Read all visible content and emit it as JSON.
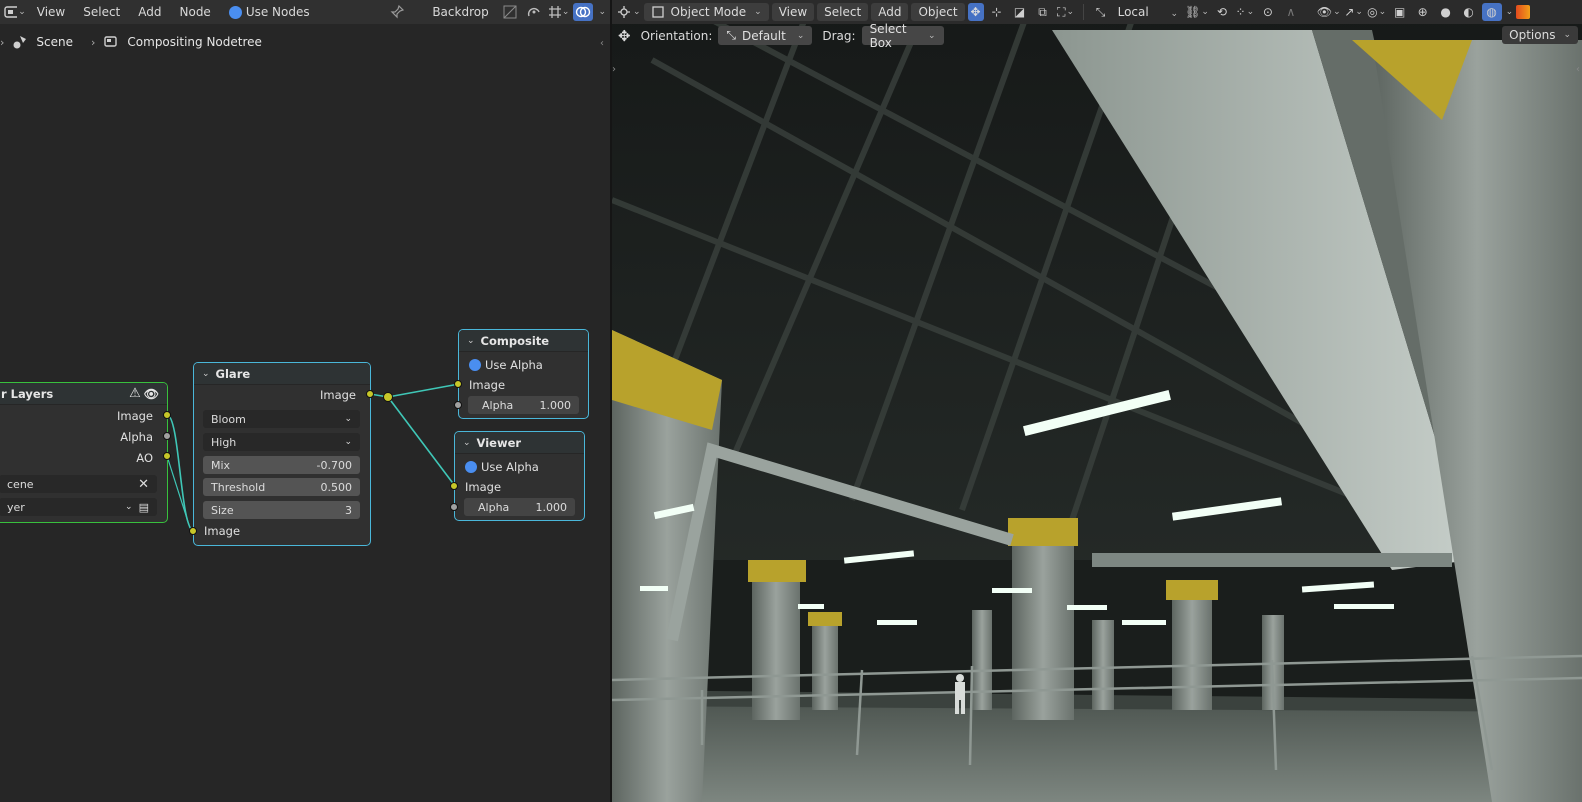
{
  "node_editor": {
    "header": {
      "editor_type_icon": "compositor-icon",
      "menus": [
        "View",
        "Select",
        "Add",
        "Node"
      ],
      "use_nodes_label": "Use Nodes",
      "backdrop_label": "Backdrop"
    },
    "breadcrumb": {
      "scene": "Scene",
      "nodetree": "Compositing Nodetree"
    },
    "nodes": {
      "render_layers": {
        "title": "r Layers",
        "outputs": [
          "Image",
          "Alpha",
          "AO"
        ],
        "scene_field": "cene",
        "layer_field": "yer"
      },
      "glare": {
        "title": "Glare",
        "output": "Image",
        "type": "Bloom",
        "quality": "High",
        "mix_label": "Mix",
        "mix_value": "-0.700",
        "threshold_label": "Threshold",
        "threshold_value": "0.500",
        "size_label": "Size",
        "size_value": "3",
        "input": "Image"
      },
      "composite": {
        "title": "Composite",
        "use_alpha": "Use Alpha",
        "input": "Image",
        "alpha_label": "Alpha",
        "alpha_value": "1.000"
      },
      "viewer": {
        "title": "Viewer",
        "use_alpha": "Use Alpha",
        "input": "Image",
        "alpha_label": "Alpha",
        "alpha_value": "1.000"
      }
    }
  },
  "viewport": {
    "header": {
      "mode": "Object Mode",
      "menus": [
        "View",
        "Select",
        "Add",
        "Object"
      ],
      "transform_orientation": "Local"
    },
    "toolbar": {
      "orientation_label": "Orientation:",
      "orientation_value": "Default",
      "drag_label": "Drag:",
      "drag_value": "Select Box",
      "options_label": "Options"
    }
  },
  "colors": {
    "accent_blue": "#4a8ef0",
    "selected_node_border": "#4ab7d9",
    "active_node_border": "#38c03d",
    "socket_yellow": "#c7c729",
    "link_teal": "#3fc7b7"
  }
}
